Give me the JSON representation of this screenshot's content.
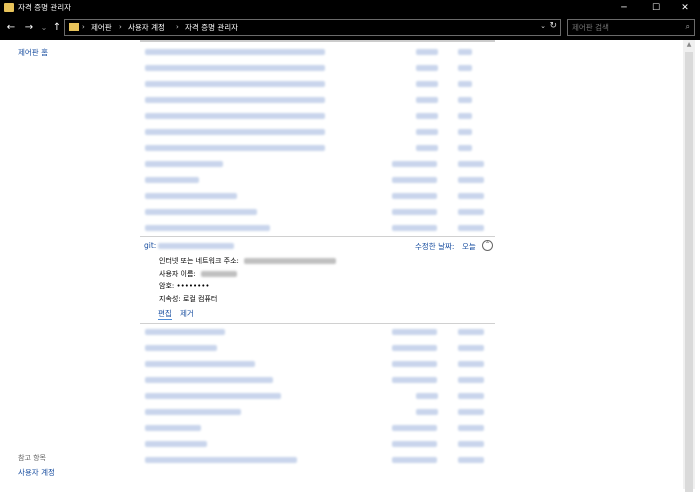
{
  "window": {
    "title": "자격 증명 관리자",
    "minimize": "─",
    "maximize": "☐",
    "close": "✕"
  },
  "nav": {
    "back": "←",
    "forward": "→",
    "recent": "⌄",
    "up": "↑"
  },
  "address": {
    "crumbs": [
      "제어판",
      "사용자 계정",
      "자격 증명 관리자"
    ],
    "separator": "›",
    "dropdown": "⌄",
    "refresh": "↻"
  },
  "search": {
    "placeholder": "제어판 검색",
    "icon": "⌕"
  },
  "left_pane": {
    "home": "제어판 홈",
    "see_also": "참고 항목",
    "user_accounts": "사용자 계정"
  },
  "expanded": {
    "name_prefix": "git:",
    "modified_label": "수정한 날짜:",
    "modified_value": "오늘",
    "collapse_icon": "⌃",
    "address_label": "인터넷 또는 네트워크 주소:",
    "username_label": "사용자 이름:",
    "password_label": "암호:",
    "password_value": "••••••••",
    "persistence_label": "지속성:",
    "persistence_value": "로컬 컴퓨터",
    "edit": "편집",
    "remove": "제거"
  },
  "colors": {
    "titlebar": "#000000",
    "link": "#1a4fa0",
    "blurred_text": "#c9d5ec"
  }
}
